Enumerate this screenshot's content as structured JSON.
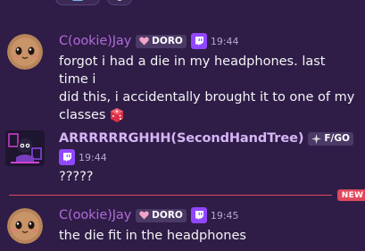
{
  "messages": [
    {
      "username": "C(ookie)Jay",
      "tag": "DORO",
      "time": "19:44",
      "lines": [
        "forgot i had a die in my headphones. last time i",
        "did this, i accidentally brought it to one of my",
        "classes"
      ]
    },
    {
      "username": "ARRRRRRGHHH(SecondHandTree)",
      "tag": "F/GO",
      "time": "19:44",
      "lines": [
        "?????"
      ]
    },
    {
      "username": "C(ookie)Jay",
      "tag": "DORO",
      "time": "19:45",
      "lines": [
        "the die fit in the headphones"
      ]
    }
  ],
  "divider": {
    "label": "NEW",
    "color": "#e0485d"
  },
  "icons": {
    "tag_doro": "heart-icon",
    "tag_fgo": "sparkle-icon",
    "twitch": "twitch-icon",
    "emoji": "game-die-icon"
  },
  "colors": {
    "background": "#2f1d47",
    "jay": "#b06ad8",
    "arr": "#d6b5f7",
    "twitch": "#9146ff"
  }
}
